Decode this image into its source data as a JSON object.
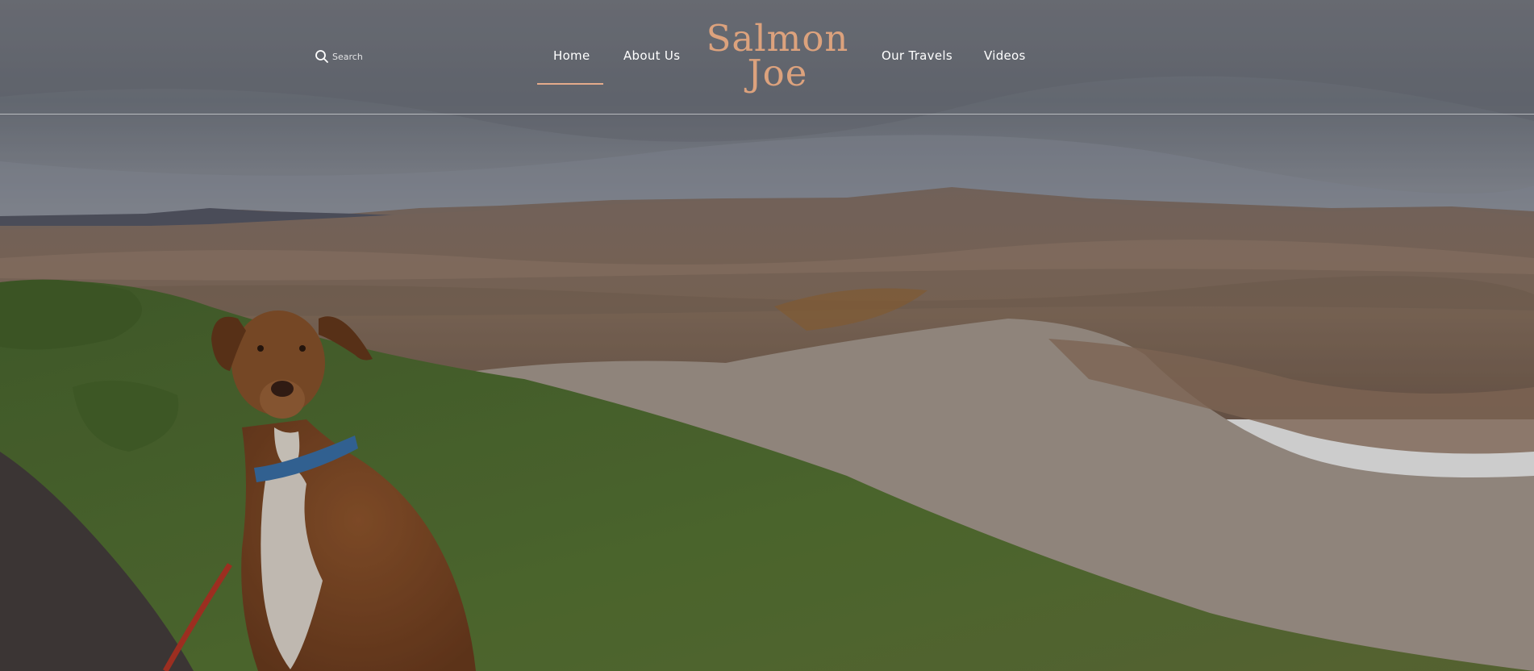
{
  "header": {
    "search": {
      "placeholder": "Search",
      "icon": "search-icon"
    },
    "nav": {
      "home": "Home",
      "about": "About Us",
      "travels": "Our Travels",
      "videos": "Videos"
    },
    "logo": {
      "line1": "Salmon",
      "line2": "Joe"
    },
    "active_item": "Home"
  },
  "hero": {
    "image": "badlands landscape with brown dog wearing blue collar sitting on grassy hill"
  },
  "colors": {
    "accent": "#e4ab8b",
    "logo": "#dca27d",
    "nav_text": "#ffffff",
    "divider": "#ffffff"
  }
}
